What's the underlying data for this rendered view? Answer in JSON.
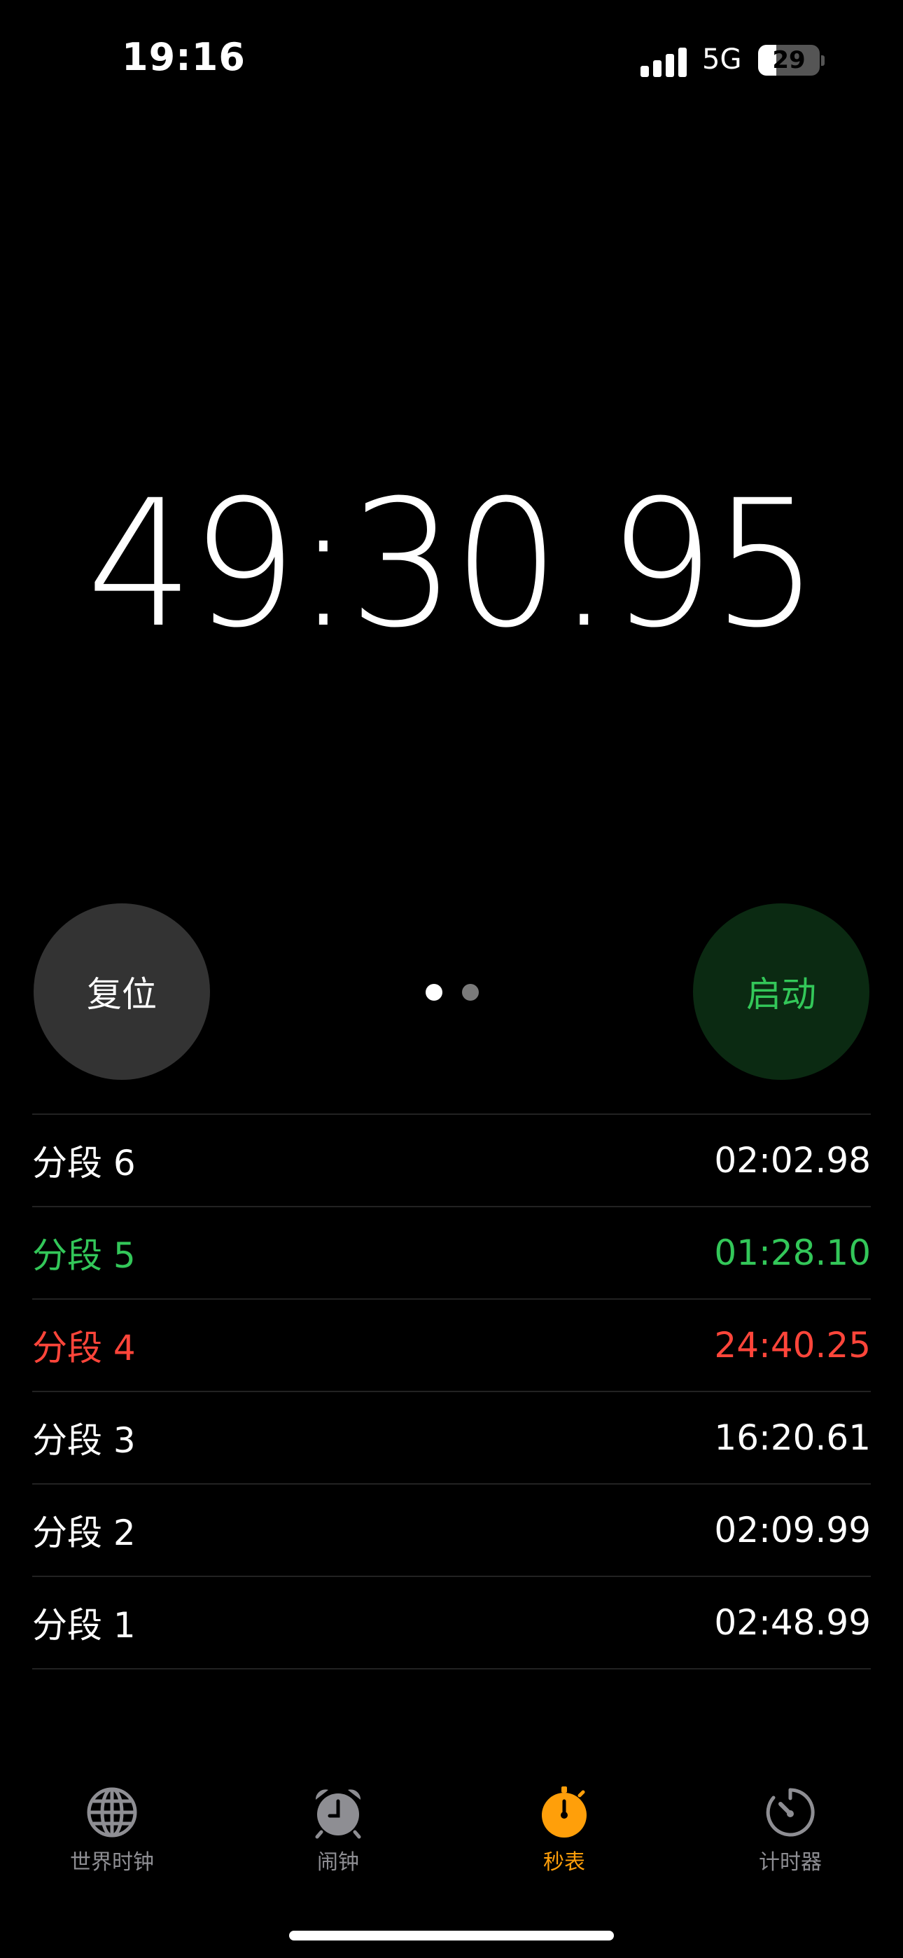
{
  "status_bar": {
    "time": "19:16",
    "network": "5G",
    "battery_percent": "29",
    "battery_level": 0.29
  },
  "stopwatch": {
    "time": "49:30.95"
  },
  "controls": {
    "reset_label": "复位",
    "start_label": "启动",
    "page_count": 2,
    "active_page": 0
  },
  "laps": [
    {
      "label": "分段 6",
      "time": "02:02.98",
      "color": "#ffffff"
    },
    {
      "label": "分段 5",
      "time": "01:28.10",
      "color": "#33c759"
    },
    {
      "label": "分段 4",
      "time": "24:40.25",
      "color": "#ff453a"
    },
    {
      "label": "分段 3",
      "time": "16:20.61",
      "color": "#ffffff"
    },
    {
      "label": "分段 2",
      "time": "02:09.99",
      "color": "#ffffff"
    },
    {
      "label": "分段 1",
      "time": "02:48.99",
      "color": "#ffffff"
    }
  ],
  "tabs": [
    {
      "label": "世界时钟",
      "icon": "globe-icon",
      "active": false
    },
    {
      "label": "闹钟",
      "icon": "alarm-clock-icon",
      "active": false
    },
    {
      "label": "秒表",
      "icon": "stopwatch-icon",
      "active": true
    },
    {
      "label": "计时器",
      "icon": "timer-icon",
      "active": false
    }
  ],
  "colors": {
    "accent": "#ff9f0a",
    "inactive_tab": "#8e8e93",
    "fastest_lap": "#33c759",
    "slowest_lap": "#ff453a"
  }
}
